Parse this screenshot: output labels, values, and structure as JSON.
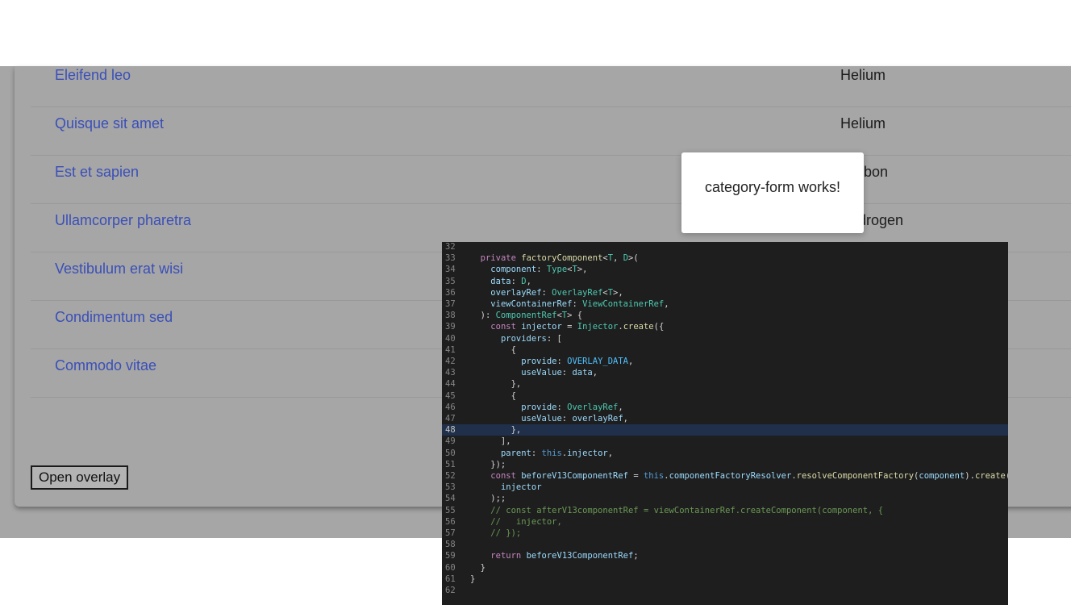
{
  "list": {
    "rows": [
      {
        "name": "Eleifend leo",
        "value": "Helium"
      },
      {
        "name": "Quisque sit amet",
        "value": "Helium"
      },
      {
        "name": "Est et sapien",
        "value": "Carbon"
      },
      {
        "name": "Ullamcorper pharetra",
        "value": "Hydrogen"
      },
      {
        "name": "Vestibulum erat wisi",
        "value": ""
      },
      {
        "name": "Condimentum sed",
        "value": ""
      },
      {
        "name": "Commodo vitae",
        "value": ""
      }
    ]
  },
  "actions": {
    "open_overlay_label": "Open overlay"
  },
  "overlay": {
    "message": "category-form works!"
  },
  "code_panel": {
    "colors": {
      "background": "#1e1e1e",
      "keyword": "#c586c0",
      "function": "#dcdcaa",
      "type": "#4ec9b0",
      "variable": "#9cdcfe",
      "constant": "#4fc1ff",
      "comment": "#6a9955",
      "this": "#569cd6"
    },
    "lines": [
      {
        "n": "32",
        "t": ""
      },
      {
        "n": "33",
        "t": "  private factoryComponent<T, D>("
      },
      {
        "n": "34",
        "t": "    component: Type<T>,"
      },
      {
        "n": "35",
        "t": "    data: D,"
      },
      {
        "n": "36",
        "t": "    overlayRef: OverlayRef<T>,"
      },
      {
        "n": "37",
        "t": "    viewContainerRef: ViewContainerRef,"
      },
      {
        "n": "38",
        "t": "  ): ComponentRef<T> {"
      },
      {
        "n": "39",
        "t": "    const injector = Injector.create({"
      },
      {
        "n": "40",
        "t": "      providers: ["
      },
      {
        "n": "41",
        "t": "        {"
      },
      {
        "n": "42",
        "t": "          provide: OVERLAY_DATA,"
      },
      {
        "n": "43",
        "t": "          useValue: data,"
      },
      {
        "n": "44",
        "t": "        },"
      },
      {
        "n": "45",
        "t": "        {"
      },
      {
        "n": "46",
        "t": "          provide: OverlayRef,"
      },
      {
        "n": "47",
        "t": "          useValue: overlayRef,"
      },
      {
        "n": "48",
        "t": "        },"
      },
      {
        "n": "49",
        "t": "      ],"
      },
      {
        "n": "50",
        "t": "      parent: this.injector,"
      },
      {
        "n": "51",
        "t": "    });"
      },
      {
        "n": "52",
        "t": "    const beforeV13ComponentRef = this.componentFactoryResolver.resolveComponentFactory(component).create("
      },
      {
        "n": "53",
        "t": "      injector"
      },
      {
        "n": "54",
        "t": "    );;"
      },
      {
        "n": "55",
        "t": "    // const afterV13componentRef = viewContainerRef.createComponent(component, {"
      },
      {
        "n": "56",
        "t": "    //   injector,"
      },
      {
        "n": "57",
        "t": "    // });"
      },
      {
        "n": "58",
        "t": ""
      },
      {
        "n": "59",
        "t": "    return beforeV13ComponentRef;"
      },
      {
        "n": "60",
        "t": "  }"
      },
      {
        "n": "61",
        "t": "}"
      },
      {
        "n": "62",
        "t": ""
      }
    ],
    "current_line": "48"
  }
}
